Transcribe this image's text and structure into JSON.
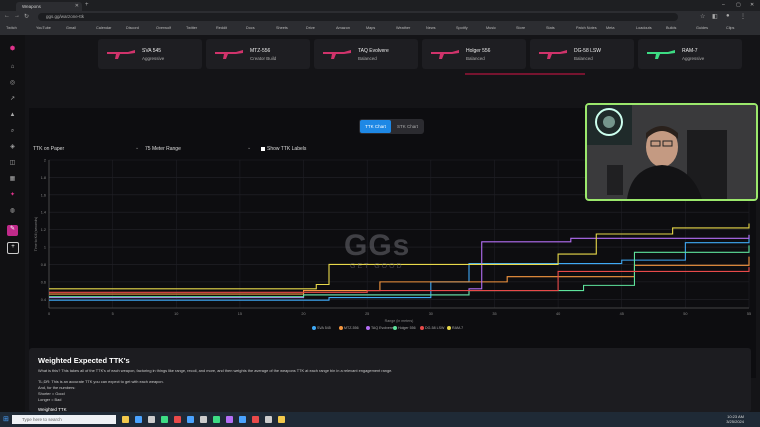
{
  "browser": {
    "tab_title": "Weapons",
    "address": "ggs.gg/warzone-ttk",
    "bookmarks": [
      "Twitch",
      "YouTube",
      "Gmail",
      "Calendar",
      "Discord",
      "Overwolf",
      "Twitter",
      "Reddit",
      "Docs",
      "Sheets",
      "Drive",
      "Amazon",
      "Maps",
      "Weather",
      "News",
      "Spotify",
      "Music",
      "Store",
      "Stats",
      "Patch Notes",
      "Meta",
      "Loadouts",
      "Builds",
      "Guides",
      "Clips"
    ]
  },
  "weapons": [
    {
      "name": "SVA 545",
      "type": "Aggressive",
      "color": "#d0336b"
    },
    {
      "name": "MTZ-556",
      "type": "Creator Build",
      "color": "#d0336b"
    },
    {
      "name": "TAQ Evolvere",
      "type": "Balanced",
      "color": "#d0336b"
    },
    {
      "name": "Holger 556",
      "type": "Balanced",
      "color": "#d0336b"
    },
    {
      "name": "DG-58 LSW",
      "type": "Balanced",
      "color": "#d0336b"
    },
    {
      "name": "RAM-7",
      "type": "Aggressive",
      "color": "#3ddc84"
    }
  ],
  "controls": {
    "toggle_active": "TTK Chart",
    "toggle_inactive": "STK Chart",
    "ttk_mode": "TTK on Paper",
    "range_mode": "Meter Range",
    "show_labels": "Show TTK Labels"
  },
  "chart_data": {
    "type": "line",
    "ylabel": "Time to Kill (seconds)",
    "xlabel": "Range (in meters)",
    "x_ticks": [
      0,
      5,
      10,
      15,
      20,
      25,
      30,
      35,
      40,
      45,
      50,
      55
    ],
    "y_ticks": [
      0.4,
      0.6,
      0.8,
      1,
      1.2,
      1.4,
      1.6,
      1.8,
      2
    ],
    "xlim": [
      0,
      55
    ],
    "ylim": [
      0.3,
      2.0
    ],
    "grid": true,
    "legend_position": "bottom",
    "series": [
      {
        "name": "SVA 545",
        "color": "#3fa9f5",
        "x": [
          0,
          22,
          30,
          33,
          45,
          50,
          55
        ],
        "y": [
          0.39,
          0.42,
          0.6,
          0.81,
          0.85,
          1.05,
          1.14
        ]
      },
      {
        "name": "MTZ-556",
        "color": "#f5963f",
        "x": [
          0,
          20,
          26,
          36,
          46,
          55
        ],
        "y": [
          0.46,
          0.5,
          0.6,
          0.66,
          0.79,
          0.89
        ]
      },
      {
        "name": "TAQ Evolvere",
        "color": "#b46ef5",
        "x": [
          0,
          20,
          33,
          34,
          41,
          55
        ],
        "y": [
          0.42,
          0.45,
          0.52,
          1.06,
          1.1,
          1.14
        ]
      },
      {
        "name": "Holger 556",
        "color": "#5ee39c",
        "x": [
          0,
          20,
          33,
          42,
          46,
          55
        ],
        "y": [
          0.43,
          0.45,
          0.5,
          0.56,
          0.94,
          1.02
        ]
      },
      {
        "name": "DG-58 LSW",
        "color": "#e84a4a",
        "x": [
          0,
          25,
          40,
          55
        ],
        "y": [
          0.48,
          0.5,
          0.72,
          0.77
        ]
      },
      {
        "name": "RAM-7",
        "color": "#e8d94a",
        "x": [
          0,
          21,
          22,
          40,
          43,
          49,
          55
        ],
        "y": [
          0.52,
          0.57,
          0.8,
          0.92,
          1.15,
          1.22,
          1.27
        ]
      }
    ]
  },
  "watermark": {
    "logo": "GGs",
    "tagline": "GET GOOD"
  },
  "explanation": {
    "title": "Weighted Expected TTK's",
    "line1": "What is this? This takes all of the TTK's of each weapon, factoring in things like range, recoil, and more, and then weights the average of the weapons TTK at each range bin in a relevant engagement range.",
    "line2": "TL;DR: This is an accurate TTK you can expect to get with each weapon.",
    "line3": "And, for the numbers:",
    "line4": "Shorter = Good",
    "line5": "Longer = Bad",
    "subheading": "Weighted TTK"
  },
  "taskbar": {
    "search_placeholder": "Type here to search",
    "time": "10:23 AM",
    "date": "3/25/2024"
  }
}
